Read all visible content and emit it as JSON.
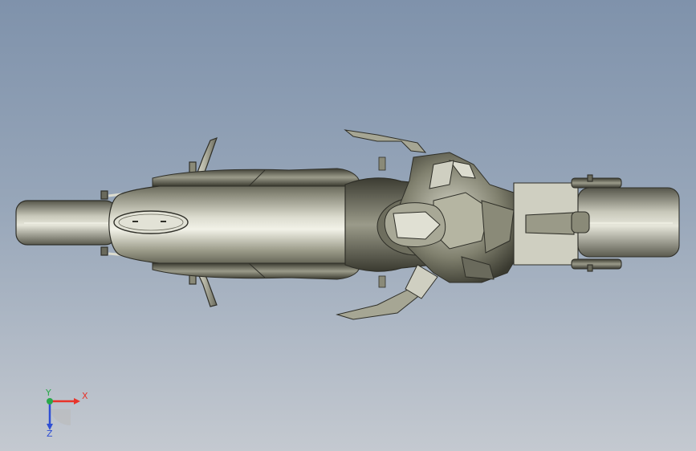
{
  "viewport": {
    "content": "3d-motorcycle-model-top-view"
  },
  "triad": {
    "x_label": "X",
    "y_label": "Y",
    "z_label": "Z",
    "x_color": "#e8332a",
    "y_color": "#2aa84a",
    "z_color": "#2f4fd4"
  }
}
